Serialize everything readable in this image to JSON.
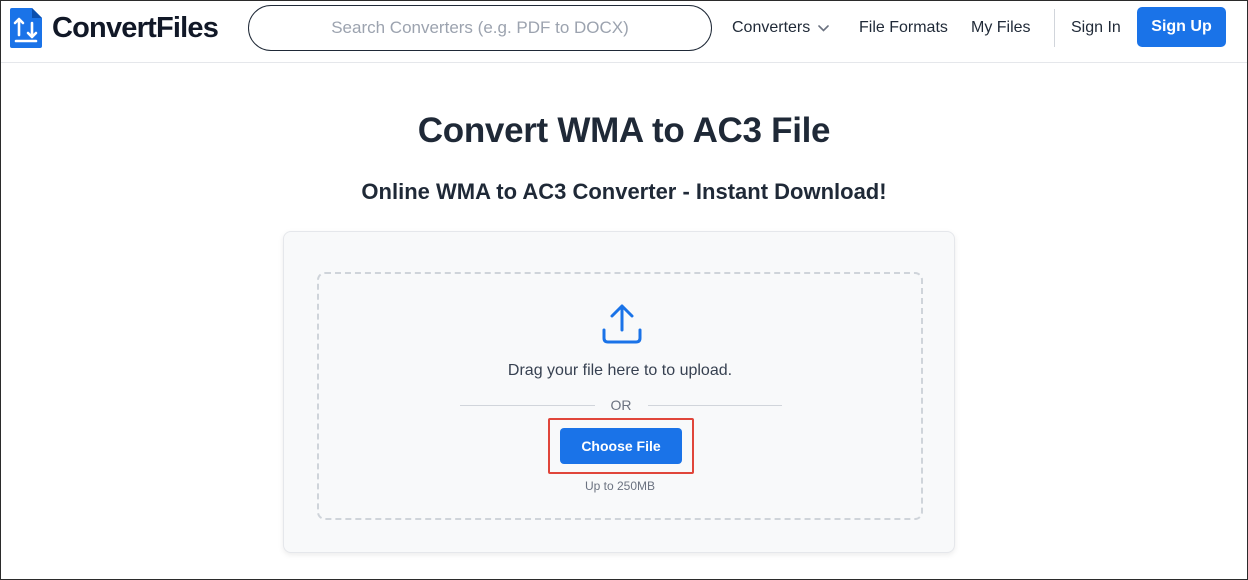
{
  "header": {
    "logo_text": "ConvertFiles",
    "search_placeholder": "Search Converters (e.g. PDF to DOCX)",
    "nav": {
      "converters": "Converters",
      "file_formats": "File Formats",
      "my_files": "My Files",
      "sign_in": "Sign In",
      "sign_up": "Sign Up"
    }
  },
  "main": {
    "title": "Convert WMA to AC3 File",
    "subtitle": "Online WMA to AC3 Converter - Instant Download!",
    "upload": {
      "drag_text": "Drag your file here to to upload.",
      "or_text": "OR",
      "choose_button": "Choose File",
      "limit_text": "Up to 250MB"
    }
  },
  "icons": {
    "logo": "convertfiles-logo-icon",
    "converters_dropdown": "chevron-down-icon",
    "upload": "upload-icon"
  },
  "colors": {
    "primary": "#1a73e8",
    "highlight_border": "#e0453a",
    "text": "#1f2937",
    "card_bg": "#f8f9fa"
  }
}
